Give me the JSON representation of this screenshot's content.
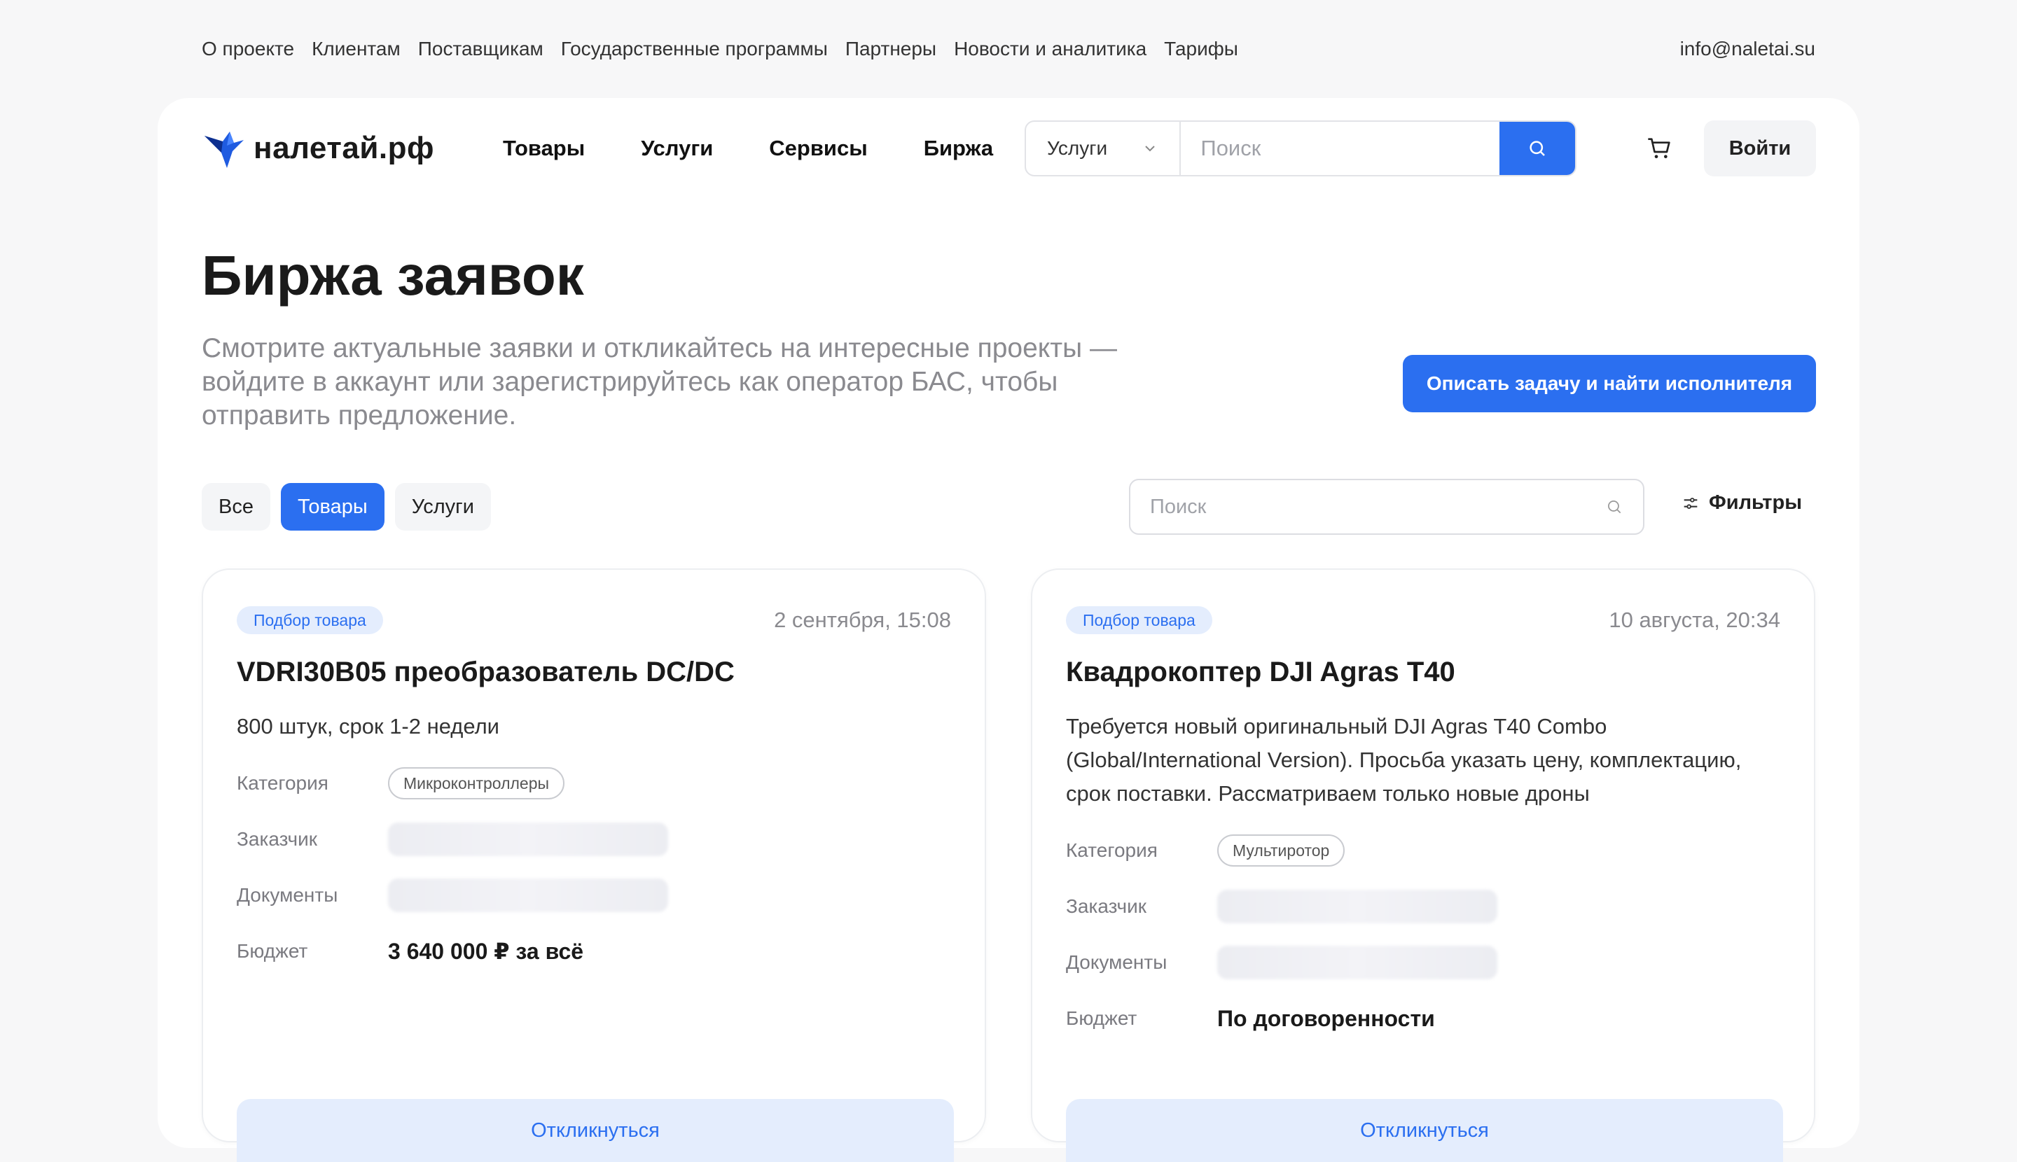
{
  "topnav": {
    "links": [
      "О проекте",
      "Клиентам",
      "Поставщикам",
      "Государственные программы",
      "Партнеры",
      "Новости и аналитика",
      "Тарифы"
    ],
    "email": "info@naletai.su"
  },
  "header": {
    "logo_text": "налетай.рф",
    "nav": [
      "Товары",
      "Услуги",
      "Сервисы",
      "Биржа"
    ],
    "search_select": "Услуги",
    "search_placeholder": "Поиск",
    "login_label": "Войти"
  },
  "page": {
    "title": "Биржа заявок",
    "subtitle": "Смотрите актуальные заявки и откликайтесь на интересные проекты — войдите в аккаунт или зарегистрируйтесь как оператор БАС, чтобы отправить предложение.",
    "cta_label": "Описать задачу и найти исполнителя"
  },
  "tabs": [
    {
      "label": "Все",
      "active": false
    },
    {
      "label": "Товары",
      "active": true
    },
    {
      "label": "Услуги",
      "active": false
    }
  ],
  "list_search_placeholder": "Поиск",
  "filters_label": "Фильтры",
  "labels": {
    "category": "Категория",
    "customer": "Заказчик",
    "documents": "Документы",
    "budget": "Бюджет",
    "respond": "Откликнуться"
  },
  "cards": [
    {
      "badge": "Подбор товара",
      "date": "2 сентября, 15:08",
      "title": "VDRI30B05 преобразователь DC/DC",
      "description": "800 штук, срок 1-2 недели",
      "category": "Микроконтроллеры",
      "budget": "3 640 000 ₽ за всё"
    },
    {
      "badge": "Подбор товара",
      "date": "10 августа, 20:34",
      "title": "Квадрокоптер DJI Agras T40",
      "description": "Требуется новый оригинальный DJI Agras T40 Combo (Global/International Version). Просьба указать цену, комплектацию, срок поставки. Рассматриваем только новые дроны",
      "category": "Мультиротор",
      "budget": "По договоренности"
    }
  ],
  "colors": {
    "accent": "#2b6ff0",
    "badge_bg": "#e4edfd",
    "page_bg": "#f7f7f8"
  }
}
